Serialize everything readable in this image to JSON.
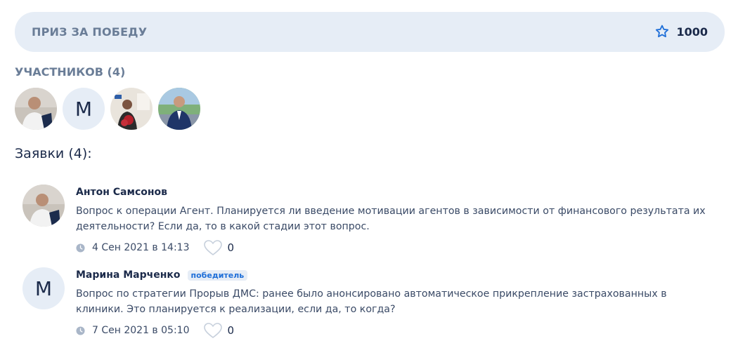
{
  "prize": {
    "label": "ПРИЗ ЗА ПОБЕДУ",
    "value": "1000",
    "icon": "star-outline-icon"
  },
  "participants": {
    "title": "УЧАСТНИКОВ (4)",
    "avatars": [
      {
        "type": "photo",
        "icon": "avatar-photo"
      },
      {
        "type": "letter",
        "letter": "М"
      },
      {
        "type": "photo",
        "icon": "avatar-photo"
      },
      {
        "type": "photo",
        "icon": "avatar-photo"
      }
    ]
  },
  "bids": {
    "title": "Заявки (4):",
    "items": [
      {
        "author": "Антон Самсонов",
        "avatar": {
          "type": "photo"
        },
        "text": "Вопрос к операции Агент. Планируется ли введение мотивации агентов в зависимости от финансового результата их деятельности? Если да, то в какой стадии этот вопрос.",
        "date": "4 Сен 2021 в 14:13",
        "likes": "0"
      },
      {
        "author": "Марина Марченко",
        "badge": "победитель",
        "avatar": {
          "type": "letter",
          "letter": "М"
        },
        "text": "Вопрос по стратегии Прорыв ДМС: ранее было анонсировано автоматическое прикрепление застрахованных в клиники. Это планируется к реализации, если да, то когда?",
        "date": "7 Сен 2021 в 05:10",
        "likes": "0"
      }
    ]
  },
  "colors": {
    "accent": "#1f6fd8",
    "panel": "#e6edf6",
    "muted_heading": "#6a7d97",
    "text_dark": "#1b2a4a"
  }
}
